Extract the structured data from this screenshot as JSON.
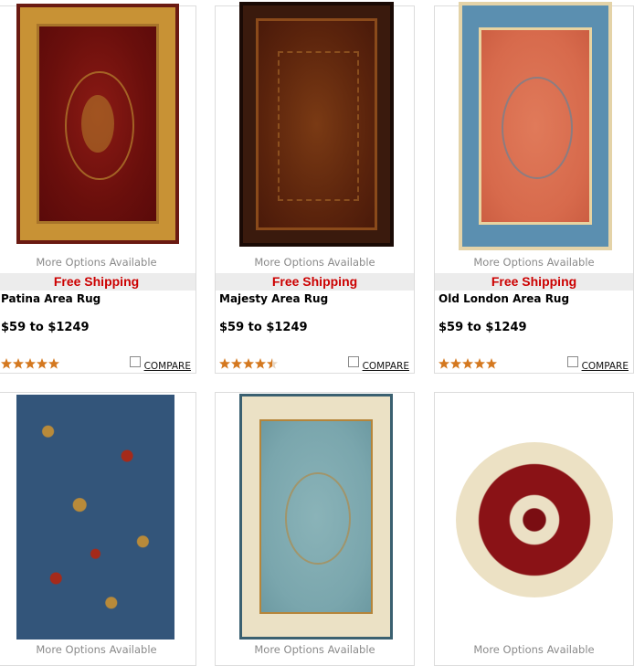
{
  "products": [
    {
      "name": "Patina Area Rug",
      "more_options": "More Options Available",
      "shipping": "Free Shipping",
      "price": "$59 to $1249",
      "rating": 5,
      "compare_label": "COMPARE"
    },
    {
      "name": "Majesty Area Rug",
      "more_options": "More Options Available",
      "shipping": "Free Shipping",
      "price": "$59 to $1249",
      "rating": 4.5,
      "compare_label": "COMPARE"
    },
    {
      "name": "Old London Area Rug",
      "more_options": "More Options Available",
      "shipping": "Free Shipping",
      "price": "$59 to $1249",
      "rating": 5,
      "compare_label": "COMPARE"
    },
    {
      "more_options": "More Options Available"
    },
    {
      "more_options": "More Options Available"
    },
    {
      "more_options": "More Options Available"
    }
  ],
  "colors": {
    "shipping_text": "#cc0000",
    "shipping_band": "#ececec",
    "star": "#d4781f",
    "border": "#dcdcdc"
  },
  "icons": {
    "star": "star-icon",
    "checkbox": "checkbox-icon"
  }
}
